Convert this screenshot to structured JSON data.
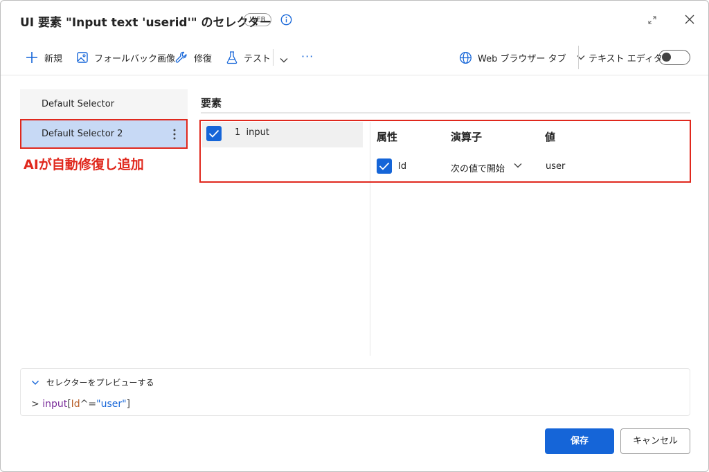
{
  "dialog": {
    "title": "UI 要素 \"Input text 'userid'\" のセレクター",
    "badge": "WEB",
    "icons": [
      "info-icon",
      "expand-icon",
      "close-icon"
    ]
  },
  "toolbar": {
    "new_label": "新規",
    "fallback_label": "フォールバック画像",
    "repair_label": "修復",
    "test_label": "テスト",
    "more_label": "···",
    "browser_tab_label": "Web ブラウザー タブ",
    "text_editor_label": "テキスト エディター",
    "text_editor_on": false
  },
  "selectors": {
    "items": [
      {
        "label": "Default Selector",
        "selected": false
      },
      {
        "label": "Default Selector 2",
        "selected": true
      }
    ],
    "annotation": "AIが自動修復し追加"
  },
  "elements": {
    "section_title": "要素",
    "rows": [
      {
        "index": "1",
        "name": "input",
        "checked": true
      }
    ]
  },
  "attributes": {
    "headers": {
      "attribute": "属性",
      "operator": "演算子",
      "value": "値"
    },
    "rows": [
      {
        "checked": true,
        "name": "Id",
        "operator": "次の値で開始",
        "value": "user"
      }
    ]
  },
  "preview": {
    "toggle_label": "セレクターをプレビューする",
    "prompt": ">",
    "code_tag": "input",
    "code_open": "[",
    "code_attr": "Id",
    "code_op": "^=",
    "code_value": "\"user\"",
    "code_close": "]"
  },
  "footer": {
    "save_label": "保存",
    "cancel_label": "キャンセル"
  },
  "colors": {
    "accent": "#1565d8",
    "highlight": "#e0281d",
    "selected_bg": "#c7d9f5"
  }
}
